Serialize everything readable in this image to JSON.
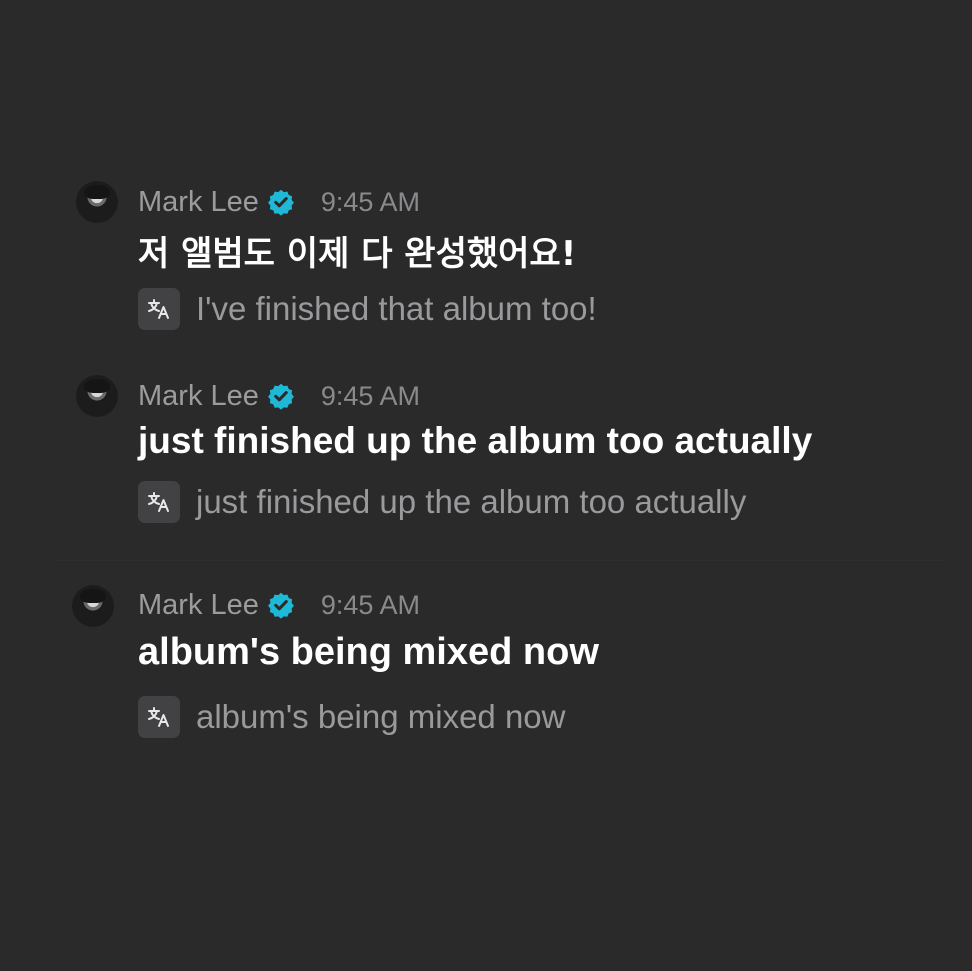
{
  "messages": [
    {
      "author": "Mark Lee",
      "time": "9:45 AM",
      "text": "저 앨범도 이제 다 완성했어요!",
      "translation": "I've finished that album too!"
    },
    {
      "author": "Mark Lee",
      "time": "9:45 AM",
      "text": "just finished up the album too actually",
      "translation": "just finished up the album too actually"
    },
    {
      "author": "Mark Lee",
      "time": "9:45 AM",
      "text": "album's being mixed now",
      "translation": "album's being mixed now"
    }
  ],
  "colors": {
    "background": "#2a2a2b",
    "verified_badge": "#1fb8d6",
    "name": "#9c9c9e",
    "message_text": "#ffffff",
    "translation_text": "#9a9a9c"
  },
  "icons": {
    "verified": "verified-badge-icon",
    "translate": "translate-icon",
    "avatar": "user-avatar"
  }
}
